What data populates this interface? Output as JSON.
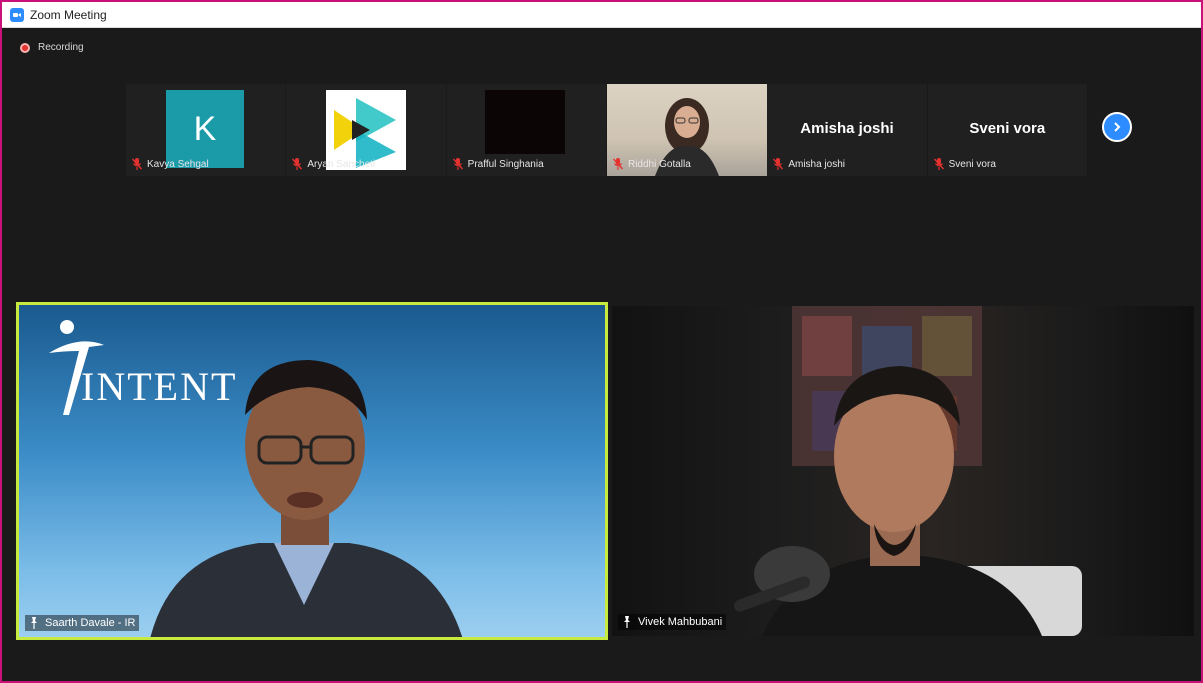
{
  "window": {
    "title": "Zoom Meeting"
  },
  "status": {
    "recording_label": "Recording"
  },
  "thumbnails": [
    {
      "name": "Kavya Sehgal",
      "avatar_letter": "K"
    },
    {
      "name": "Aryan Sancheti"
    },
    {
      "name": "Prafful Singhania"
    },
    {
      "name": "Riddhi Gotalla"
    },
    {
      "name": "Amisha joshi",
      "display_name": "Amisha joshi"
    },
    {
      "name": "Sveni vora",
      "display_name": "Sveni vora"
    }
  ],
  "main_tiles": {
    "left": {
      "name": "Saarth Davale - IR",
      "logo_text": "INTENT"
    },
    "right": {
      "name": "Vivek Mahbubani"
    }
  },
  "colors": {
    "accent": "#2d8cff",
    "active_speaker_border": "#c7ea3f",
    "window_border": "#c8127a",
    "muted_mic": "#e5312f",
    "avatar_bg": "#1b9aa8"
  },
  "icons": {
    "app": "zoom-icon",
    "recording": "recording-dot-icon",
    "muted": "mic-muted-icon",
    "next": "chevron-right-icon"
  }
}
